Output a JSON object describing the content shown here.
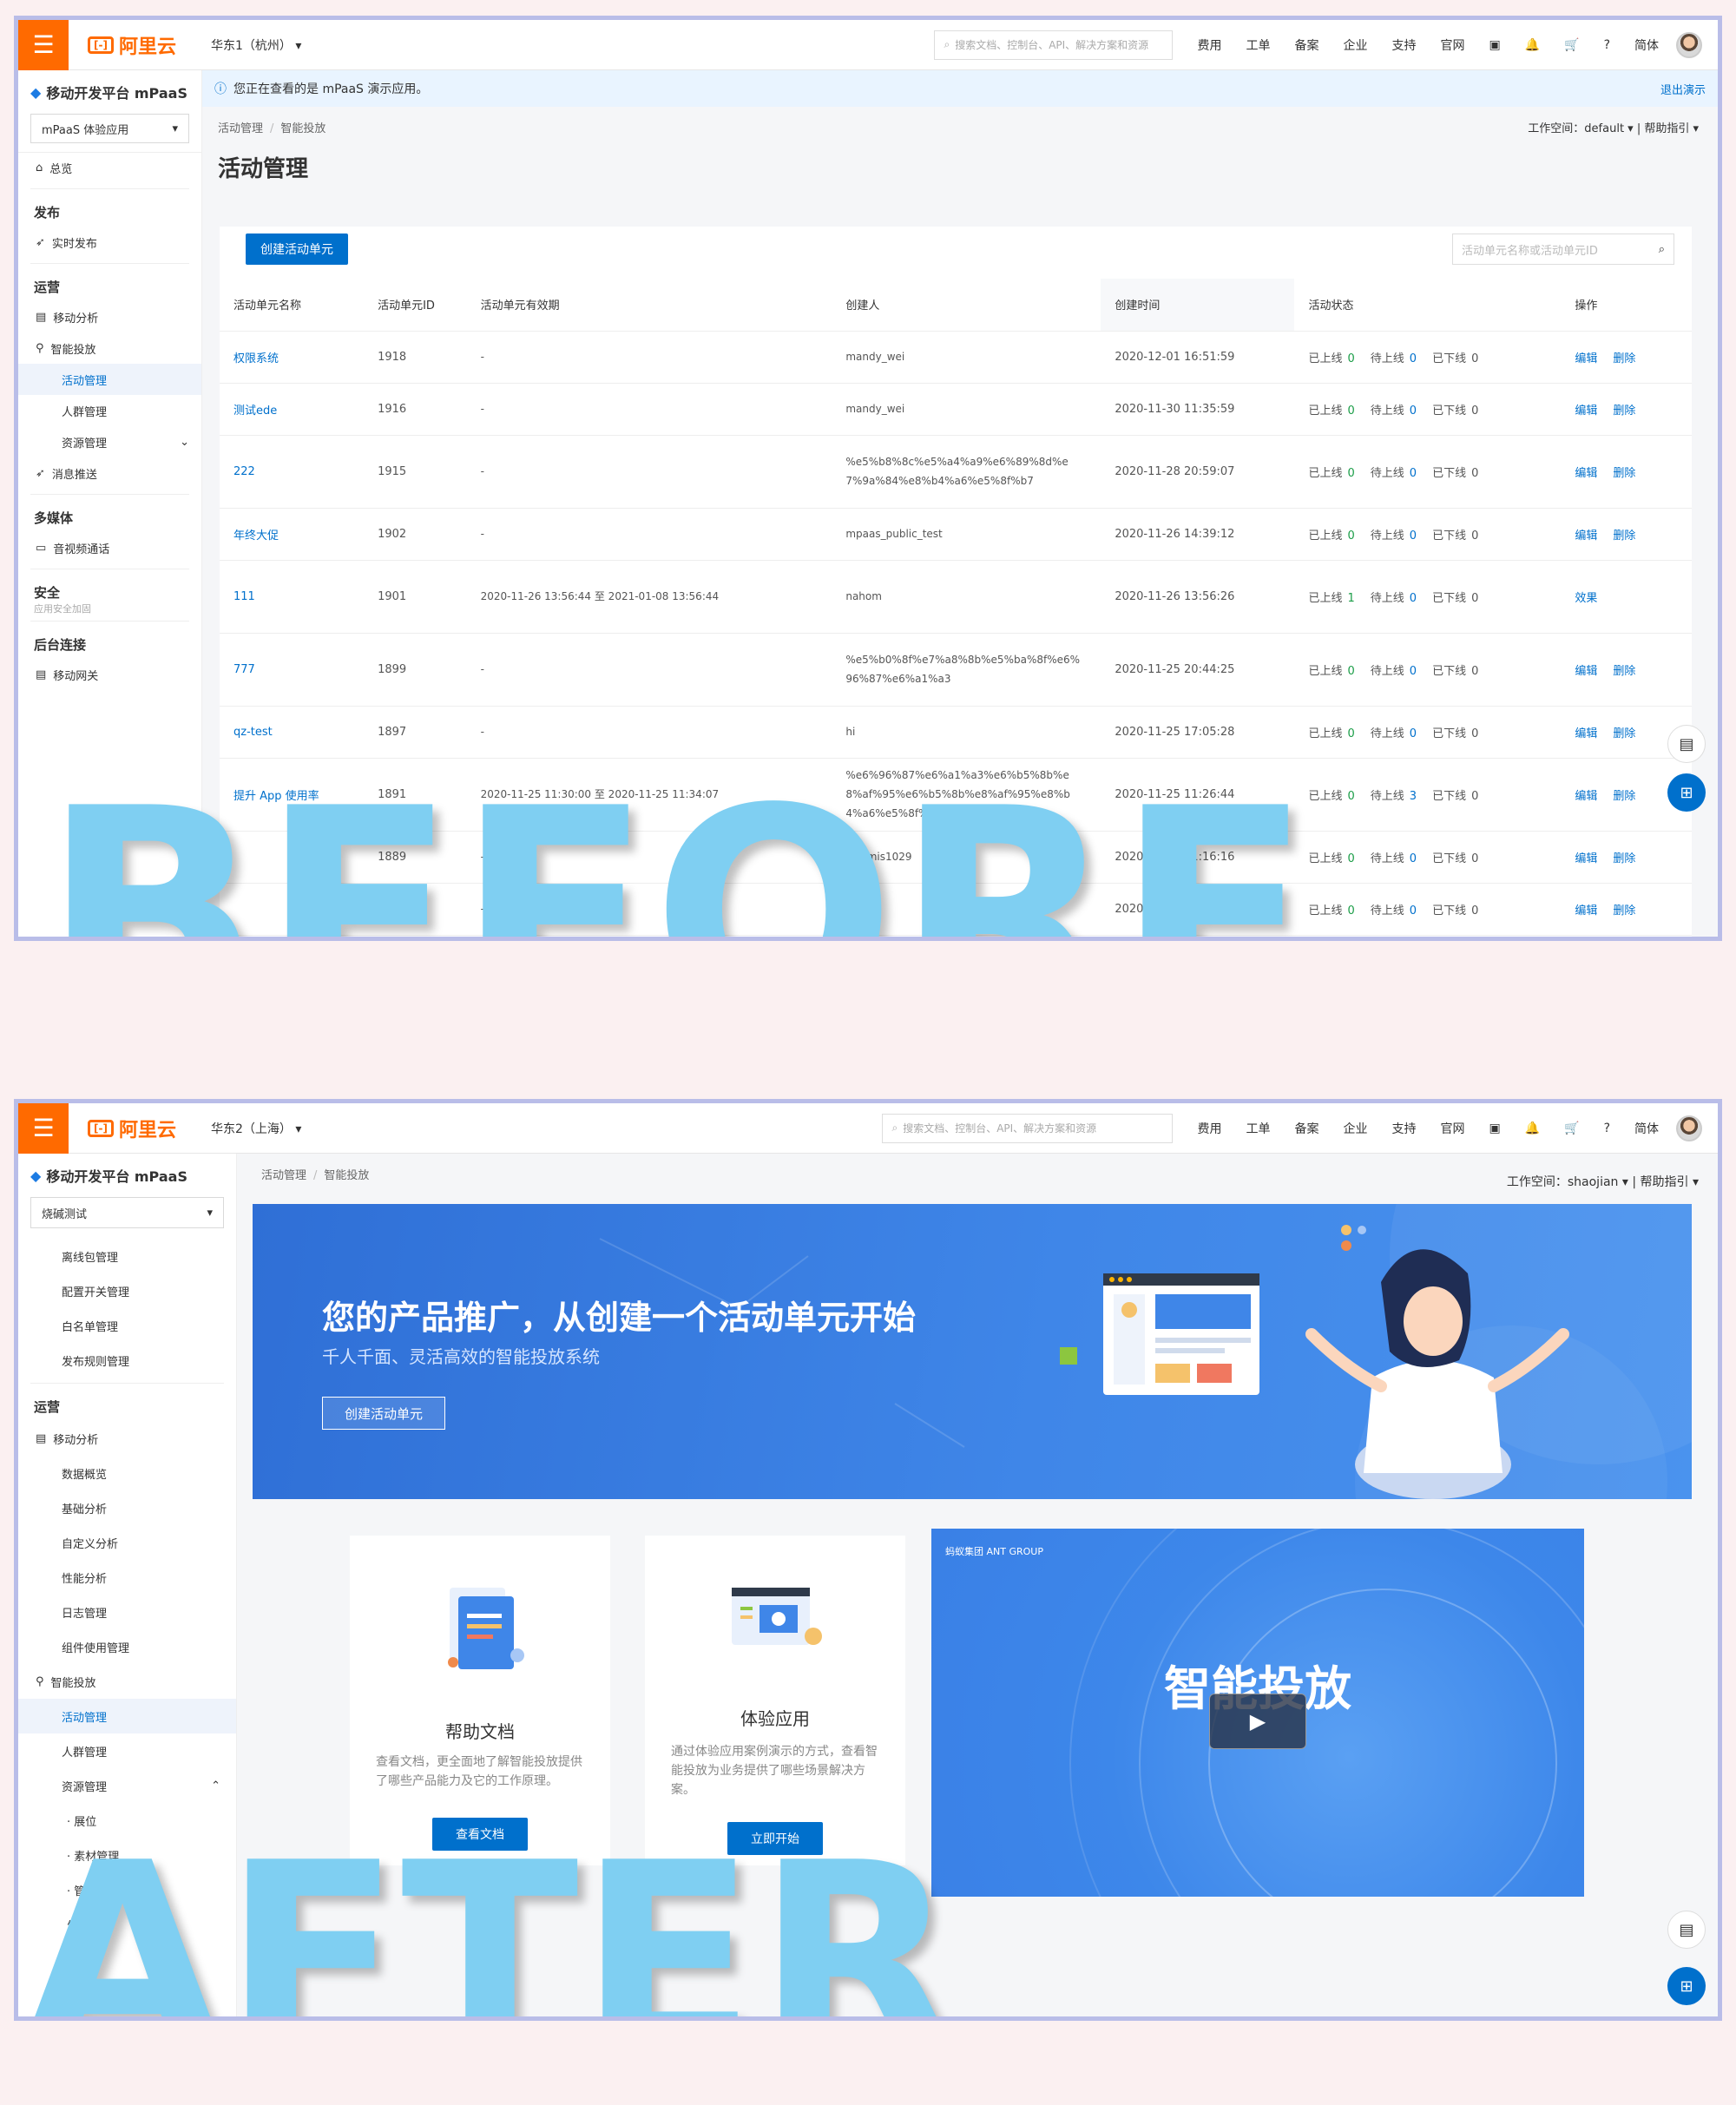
{
  "common": {
    "hamburger": "☰",
    "brand": "阿里云",
    "search_placeholder": "搜索文档、控制台、API、解决方案和资源",
    "nav": [
      "费用",
      "工单",
      "备案",
      "企业",
      "支持",
      "官网"
    ],
    "lang": "简体",
    "app_title": "移动开发平台 mPaaS",
    "breadcrumb": [
      "活动管理",
      "智能投放"
    ]
  },
  "before": {
    "label": "BEFORE",
    "region": "华东1（杭州）",
    "app_select": "mPaaS 体验应用",
    "notice": "您正在查看的是 mPaaS 演示应用。",
    "notice_action": "退出演示",
    "workspace": "工作空间：default ▾ | 帮助指引 ▾",
    "page_title": "活动管理",
    "create_button": "创建活动单元",
    "search_placeholder": "活动单元名称或活动单元ID",
    "sidebar": {
      "overview": "总览",
      "g_publish": "发布",
      "realtime_publish": "实时发布",
      "g_ops": "运营",
      "mobile_analysis": "移动分析",
      "smart_delivery": "智能投放",
      "activity_mgmt": "活动管理",
      "crowd_mgmt": "人群管理",
      "resource_mgmt": "资源管理",
      "push": "消息推送",
      "g_media": "多媒体",
      "av": "音视频通话",
      "g_security": "安全",
      "security_note": "应用安全加固",
      "g_backend": "后台连接",
      "gateway": "移动网关"
    },
    "table": {
      "headers": [
        "活动单元名称",
        "活动单元ID",
        "活动单元有效期",
        "创建人",
        "创建时间",
        "活动状态",
        "操作"
      ],
      "status_labels": [
        "已上线",
        "待上线",
        "已下线"
      ],
      "rows": [
        {
          "name": "权限系统",
          "id": "1918",
          "period": "-",
          "creator": "mandy_wei",
          "created": "2020-12-01 16:51:59",
          "s": [
            "0",
            "0",
            "0"
          ],
          "ops": [
            "编辑",
            "删除"
          ]
        },
        {
          "name": "测试ede",
          "id": "1916",
          "period": "-",
          "creator": "mandy_wei",
          "created": "2020-11-30 11:35:59",
          "s": [
            "0",
            "0",
            "0"
          ],
          "ops": [
            "编辑",
            "删除"
          ]
        },
        {
          "name": "222",
          "id": "1915",
          "period": "-",
          "creator": "%e5%b8%8c%e5%a4%a9%e6%89%8d%e7%9a%84%e8%b4%a6%e5%8f%b7",
          "created": "2020-11-28 20:59:07",
          "s": [
            "0",
            "0",
            "0"
          ],
          "ops": [
            "编辑",
            "删除"
          ]
        },
        {
          "name": "年终大促",
          "id": "1902",
          "period": "-",
          "creator": "mpaas_public_test",
          "created": "2020-11-26 14:39:12",
          "s": [
            "0",
            "0",
            "0"
          ],
          "ops": [
            "编辑",
            "删除"
          ]
        },
        {
          "name": "111",
          "id": "1901",
          "period": "2020-11-26 13:56:44 至 2021-01-08 13:56:44",
          "creator": "nahom",
          "created": "2020-11-26 13:56:26",
          "s": [
            "1",
            "0",
            "0"
          ],
          "ops": [
            "效果"
          ]
        },
        {
          "name": "777",
          "id": "1899",
          "period": "-",
          "creator": "%e5%b0%8f%e7%a8%8b%e5%ba%8f%e6%96%87%e6%a1%a3",
          "created": "2020-11-25 20:44:25",
          "s": [
            "0",
            "0",
            "0"
          ],
          "ops": [
            "编辑",
            "删除"
          ]
        },
        {
          "name": "qz-test",
          "id": "1897",
          "period": "-",
          "creator": "hi",
          "created": "2020-11-25 17:05:28",
          "s": [
            "0",
            "0",
            "0"
          ],
          "ops": [
            "编辑",
            "删除"
          ]
        },
        {
          "name": "提升 App 使用率",
          "id": "1891",
          "period": "2020-11-25 11:30:00 至 2020-11-25 11:34:07",
          "creator": "%e6%96%87%e6%a1%a3%e6%b5%8b%e8%af%95%e6%b5%8b%e8%af%95%e8%b4%a6%e5%8f%b7",
          "created": "2020-11-25 11:26:44",
          "s": [
            "0",
            "3",
            "0"
          ],
          "ops": [
            "编辑",
            "删除"
          ]
        },
        {
          "name": "",
          "id": "1889",
          "period": "-",
          "creator": "artemis1029",
          "created": "2020-11-25 11:16:16",
          "s": [
            "0",
            "0",
            "0"
          ],
          "ops": [
            "编辑",
            "删除"
          ]
        },
        {
          "name": "",
          "id": "1888",
          "period": "-",
          "creator": "",
          "created": "2020-11-25 11:13:37",
          "s": [
            "0",
            "0",
            "0"
          ],
          "ops": [
            "编辑",
            "删除"
          ]
        }
      ]
    }
  },
  "after": {
    "label": "AFTER",
    "region": "华东2（上海）",
    "app_select": "烧碱测试",
    "workspace": "工作空间：shaojian ▾ | 帮助指引 ▾",
    "sidebar": {
      "offline_pkg": "离线包管理",
      "config_switch": "配置开关管理",
      "whitelist": "白名单管理",
      "release_rules": "发布规则管理",
      "g_ops": "运营",
      "mobile_analysis": "移动分析",
      "data_overview": "数据概览",
      "basic_analysis": "基础分析",
      "custom_analysis": "自定义分析",
      "perf_analysis": "性能分析",
      "log_mgmt": "日志管理",
      "component_usage": "组件使用管理",
      "smart_delivery": "智能投放",
      "activity_mgmt": "活动管理",
      "crowd_mgmt": "人群管理",
      "resource_mgmt": "资源管理",
      "booth": "· 展位",
      "material": "· 素材管理",
      "ad_manage": "· 管理",
      "generate": "生成（公"
    },
    "banner": {
      "title": "您的产品推广，从创建一个活动单元开始",
      "subtitle": "千人千面、灵活高效的智能投放系统",
      "button": "创建活动单元"
    },
    "cards": [
      {
        "title": "帮助文档",
        "desc": "查看文档，更全面地了解智能投放提供了哪些产品能力及它的工作原理。",
        "button": "查看文档"
      },
      {
        "title": "体验应用",
        "desc": "通过体验应用案例演示的方式，查看智能投放为业务提供了哪些场景解决方案。",
        "button": "立即开始"
      }
    ],
    "video": {
      "title": "智能投放",
      "brand": "蚂蚁集团 ANT GROUP"
    }
  }
}
